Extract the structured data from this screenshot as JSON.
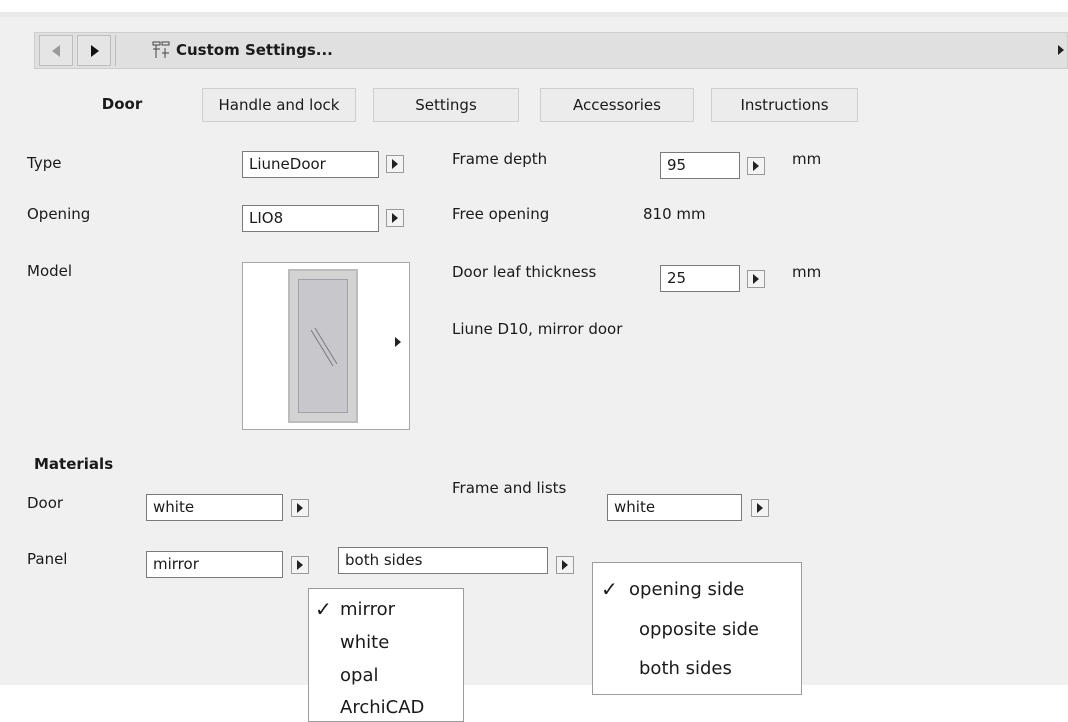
{
  "header": {
    "title": "Custom Settings...",
    "back_icon": "arrow-left-icon",
    "forward_icon": "arrow-right-icon",
    "settings_icon": "custom-settings-icon"
  },
  "tabs": {
    "active": "Door",
    "items": [
      "Handle and lock",
      "Settings",
      "Accessories",
      "Instructions"
    ]
  },
  "params": {
    "type_label": "Type",
    "type_value": "LiuneDoor",
    "opening_label": "Opening",
    "opening_value": "LIO8",
    "model_label": "Model",
    "frame_depth_label": "Frame depth",
    "frame_depth_value": "95",
    "frame_depth_unit": "mm",
    "free_opening_label": "Free opening",
    "free_opening_value": "810 mm",
    "leaf_thickness_label": "Door leaf thickness",
    "leaf_thickness_value": "25",
    "leaf_thickness_unit": "mm",
    "model_description": "Liune D10, mirror door"
  },
  "materials": {
    "heading": "Materials",
    "door_label": "Door",
    "door_value": "white",
    "frame_label": "Frame and lists",
    "frame_value": "white",
    "panel_label": "Panel",
    "panel_value": "mirror",
    "panel_side_value": "both sides"
  },
  "panel_menu": {
    "items": [
      "mirror",
      "white",
      "opal",
      "ArchiCAD"
    ],
    "checked": "mirror"
  },
  "side_menu": {
    "items": [
      "opening side",
      "opposite side",
      "both sides"
    ],
    "checked": "opening side"
  },
  "colors": {
    "panel_bg": "#f0f0f0",
    "field_border": "#7a7a7a"
  }
}
